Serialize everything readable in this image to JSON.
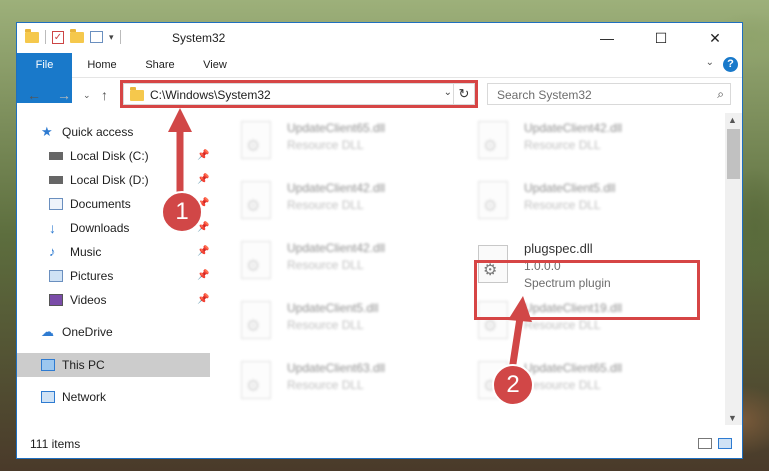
{
  "window": {
    "title": "System32",
    "caption": {
      "minimize": "—",
      "maximize": "☐",
      "close": "✕"
    }
  },
  "ribbon": {
    "tabs": [
      "File",
      "Home",
      "Share",
      "View"
    ],
    "help": "?"
  },
  "navigation": {
    "address": "C:\\Windows\\System32",
    "search_placeholder": "Search System32"
  },
  "sidebar": {
    "items": [
      {
        "label": "Quick access",
        "icon": "star-icon",
        "pinned": false
      },
      {
        "label": "Local Disk (C:)",
        "icon": "drive-icon",
        "pinned": true
      },
      {
        "label": "Local Disk (D:)",
        "icon": "drive-icon",
        "pinned": true
      },
      {
        "label": "Documents",
        "icon": "documents-icon",
        "pinned": true
      },
      {
        "label": "Downloads",
        "icon": "download-icon",
        "pinned": true
      },
      {
        "label": "Music",
        "icon": "music-icon",
        "pinned": true
      },
      {
        "label": "Pictures",
        "icon": "pictures-icon",
        "pinned": true
      },
      {
        "label": "Videos",
        "icon": "videos-icon",
        "pinned": true
      },
      {
        "label": "OneDrive",
        "icon": "cloud-icon",
        "pinned": false
      },
      {
        "label": "This PC",
        "icon": "computer-icon",
        "pinned": false,
        "selected": true
      },
      {
        "label": "Network",
        "icon": "network-icon",
        "pinned": false
      }
    ]
  },
  "files": [
    {
      "name": "UpdateClient65.dll",
      "desc": "Resource DLL"
    },
    {
      "name": "UpdateClient42.dll",
      "desc": "Resource DLL"
    },
    {
      "name": "UpdateClient42.dll",
      "desc": "Resource DLL"
    },
    {
      "name": "UpdateClient5.dll",
      "desc": "Resource DLL"
    },
    {
      "name": "UpdateClient42.dll",
      "desc": "Resource DLL"
    },
    {
      "name": "plugspec.dll",
      "version": "1.0.0.0",
      "desc": "Spectrum plugin"
    },
    {
      "name": "UpdateClient5.dll",
      "desc": "Resource DLL"
    },
    {
      "name": "UpdateClient19.dll",
      "desc": "Resource DLL"
    },
    {
      "name": "UpdateClient63.dll",
      "desc": "Resource DLL"
    },
    {
      "name": "UpdateClient65.dll",
      "desc": "Resource DLL"
    }
  ],
  "status": {
    "item_count": "111 items"
  },
  "annotations": {
    "step1": "1",
    "step2": "2",
    "color": "#d64545"
  }
}
